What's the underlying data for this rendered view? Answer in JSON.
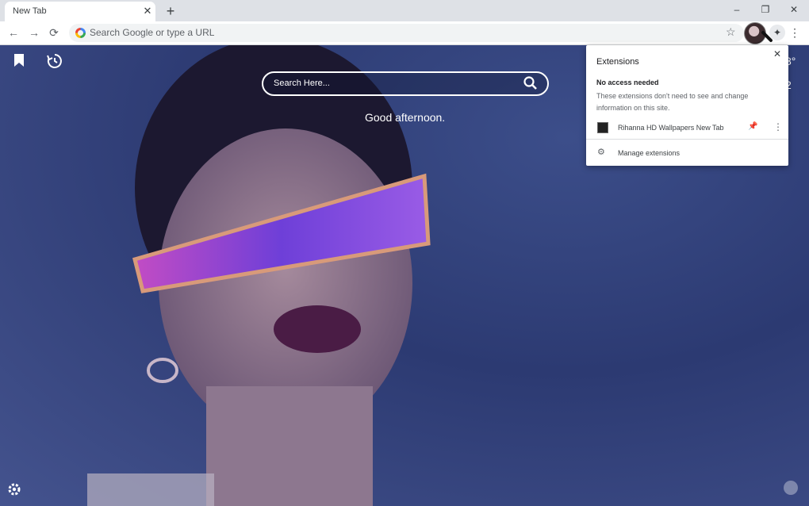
{
  "tab": {
    "title": "New Tab",
    "close": "✕",
    "new_tab": "+"
  },
  "window": {
    "minimize": "–",
    "restore": "❐",
    "close": "✕"
  },
  "toolbar": {
    "back": "←",
    "forward": "→",
    "reload": "⟳",
    "omnibox_placeholder": "Search Google or type a URL",
    "star": "☆",
    "extensions": "✦",
    "menu": "⋮"
  },
  "page": {
    "search_placeholder": "Search Here...",
    "greeting": "Good afternoon.",
    "right_fragment_1": "8°",
    "right_fragment_2": "2"
  },
  "extensions_popup": {
    "title": "Extensions",
    "close": "✕",
    "section_heading": "No access needed",
    "section_description": "These extensions don't need to see and change information on this site.",
    "items": [
      {
        "name": "Rihanna HD Wallpapers New Tab",
        "pinned": true
      }
    ],
    "pin_icon": "📌",
    "more_icon": "⋮",
    "manage_label": "Manage extensions",
    "manage_icon": "⚙"
  },
  "colors": {
    "accent": "#1a73e8",
    "background": "#2c3a72",
    "tabstrip": "#dee1e6"
  },
  "icons": [
    "bookmark-icon",
    "history-icon",
    "search-icon",
    "settings-icon",
    "apps-icon",
    "puzzle-icon",
    "pin-icon",
    "gear-icon"
  ]
}
